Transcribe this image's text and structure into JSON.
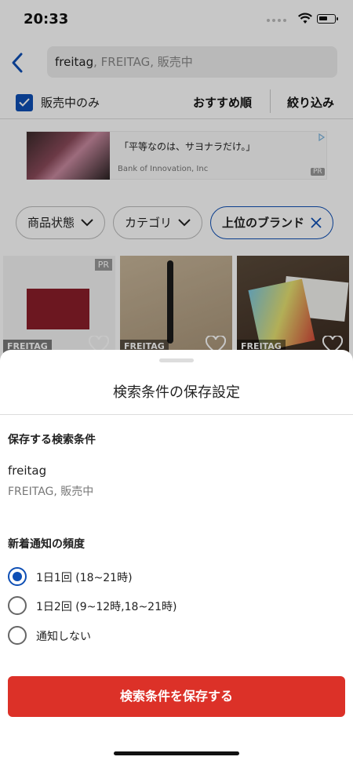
{
  "status_bar": {
    "time": "20:33"
  },
  "search": {
    "query_first": "freitag",
    "query_rest": ", FREITAG, 販売中"
  },
  "filters": {
    "on_sale_only": "販売中のみ",
    "on_sale_checked": true,
    "sort": "おすすめ順",
    "refine": "絞り込み"
  },
  "ad": {
    "title": "「平等なのは、サヨナラだけ。」",
    "sponsor": "Bank of Innovation, Inc",
    "badge": "PR"
  },
  "chips": [
    {
      "label": "商品状態",
      "icon": "chevron-down-icon"
    },
    {
      "label": "カテゴリ",
      "icon": "chevron-down-icon"
    },
    {
      "label": "上位のブランド",
      "icon": "close-icon",
      "active": true
    }
  ],
  "products": [
    {
      "brand": "FREITAG",
      "badge": "PR"
    },
    {
      "brand": "FREITAG"
    },
    {
      "brand": "FREITAG"
    }
  ],
  "sheet": {
    "title": "検索条件の保存設定",
    "saved_conditions_heading": "保存する検索条件",
    "keyword": "freitag",
    "detail": "FREITAG, 販売中",
    "frequency_heading": "新着通知の頻度",
    "options": [
      {
        "label": "1日1回 (18~21時)",
        "selected": true
      },
      {
        "label": "1日2回 (9~12時,18~21時)",
        "selected": false
      },
      {
        "label": "通知しない",
        "selected": false
      }
    ],
    "save_button": "検索条件を保存する"
  },
  "colors": {
    "accent": "#0e4fb5",
    "primary_button": "#dc3128"
  }
}
